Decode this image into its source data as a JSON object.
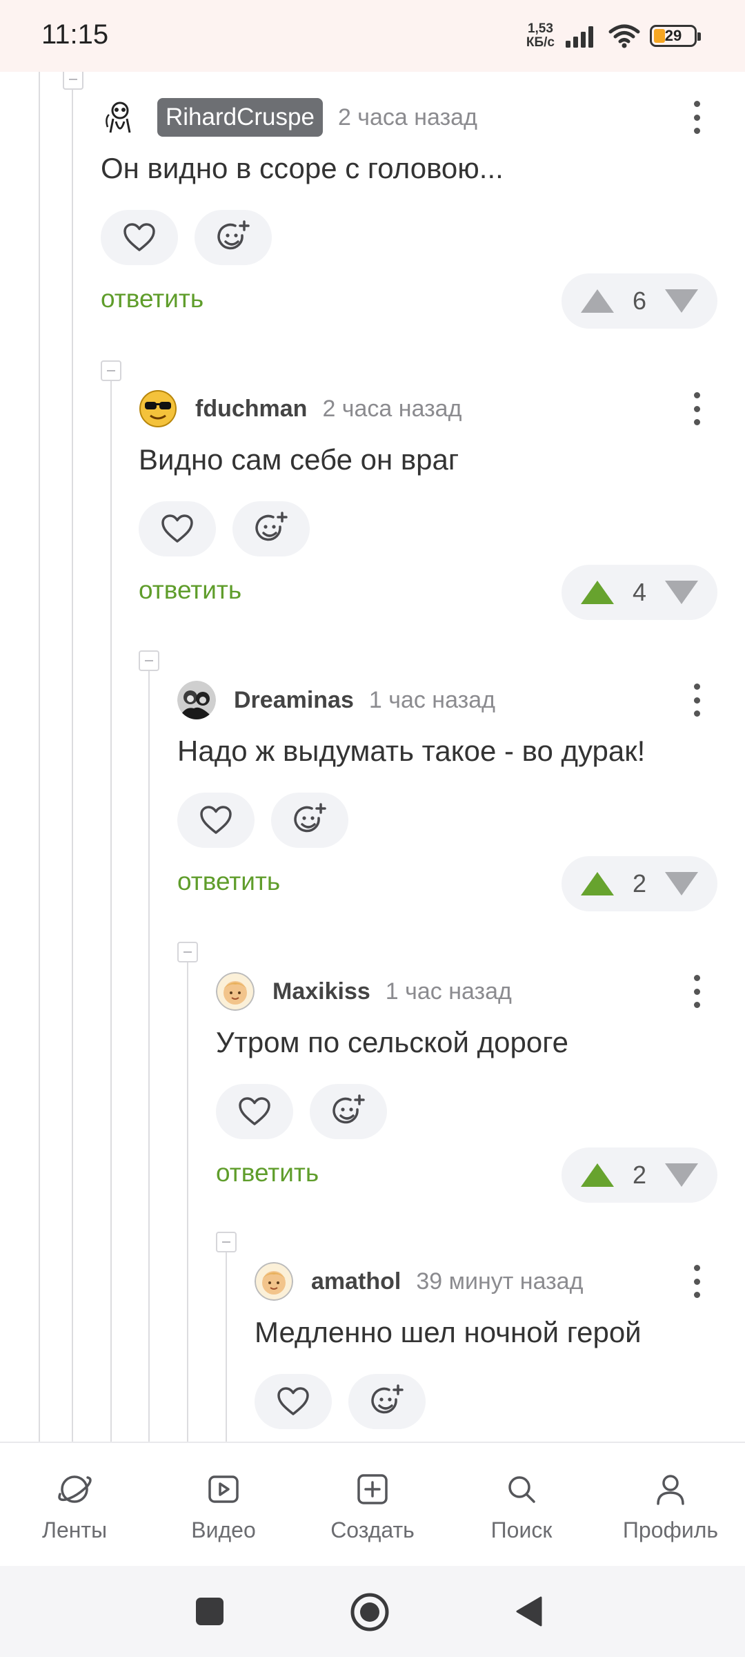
{
  "status_bar": {
    "time": "11:15",
    "net_speed_value": "1,53",
    "net_speed_unit": "КБ/с",
    "battery": "29",
    "battery_level": 0.29
  },
  "comments": [
    {
      "author": "RihardCruspe",
      "time": "2 часа назад",
      "text": "Он видно в ссоре с головою...",
      "reply": "ответить",
      "rating": "6",
      "upvoted": false,
      "avatar_icon": "lemur-avatar"
    },
    {
      "author": "fduchman",
      "time": "2 часа назад",
      "text": "Видно сам себе он враг",
      "reply": "ответить",
      "rating": "4",
      "upvoted": true,
      "avatar_icon": "sunglasses-smiley-avatar"
    },
    {
      "author": "Dreaminas",
      "time": "1 час назад",
      "text": "Надо ж выдумать такое - во дурак!",
      "reply": "ответить",
      "rating": "2",
      "upvoted": true,
      "avatar_icon": "photo-avatar"
    },
    {
      "author": "Maxikiss",
      "time": "1 час назад",
      "text": "Утром по сельской дороге",
      "reply": "ответить",
      "rating": "2",
      "upvoted": true,
      "avatar_icon": "baby-avatar"
    },
    {
      "author": "amathol",
      "time": "39 минут назад",
      "text": "Медленно шел ночной герой",
      "avatar_icon": "baby-avatar"
    }
  ],
  "nav": {
    "feeds": "Ленты",
    "video": "Видео",
    "create": "Создать",
    "search": "Поиск",
    "profile": "Профиль"
  },
  "colors": {
    "accent_green": "#67a32e",
    "reply_green": "#5f9d2b",
    "author_tag_bg": "#6d6f73",
    "status_bar_bg": "#fdf3f1"
  }
}
